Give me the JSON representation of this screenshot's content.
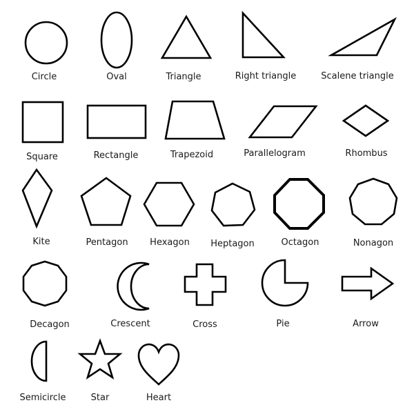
{
  "colors": {
    "stroke": "#000000",
    "text": "#1a1a1a",
    "background": "#ffffff"
  },
  "shapes": [
    {
      "name": "circle",
      "label": "Circle"
    },
    {
      "name": "oval",
      "label": "Oval"
    },
    {
      "name": "triangle",
      "label": "Triangle"
    },
    {
      "name": "right-triangle",
      "label": "Right triangle"
    },
    {
      "name": "scalene-triangle",
      "label": "Scalene triangle"
    },
    {
      "name": "square",
      "label": "Square"
    },
    {
      "name": "rectangle",
      "label": "Rectangle"
    },
    {
      "name": "trapezoid",
      "label": "Trapezoid"
    },
    {
      "name": "parallelogram",
      "label": "Parallelogram"
    },
    {
      "name": "rhombus",
      "label": "Rhombus"
    },
    {
      "name": "kite",
      "label": "Kite"
    },
    {
      "name": "pentagon",
      "label": "Pentagon"
    },
    {
      "name": "hexagon",
      "label": "Hexagon"
    },
    {
      "name": "heptagon",
      "label": "Heptagon"
    },
    {
      "name": "octagon",
      "label": "Octagon"
    },
    {
      "name": "nonagon",
      "label": "Nonagon"
    },
    {
      "name": "decagon",
      "label": "Decagon"
    },
    {
      "name": "crescent",
      "label": "Crescent"
    },
    {
      "name": "cross",
      "label": "Cross"
    },
    {
      "name": "pie",
      "label": "Pie"
    },
    {
      "name": "arrow",
      "label": "Arrow"
    },
    {
      "name": "semicircle",
      "label": "Semicircle"
    },
    {
      "name": "star",
      "label": "Star"
    },
    {
      "name": "heart",
      "label": "Heart"
    }
  ]
}
